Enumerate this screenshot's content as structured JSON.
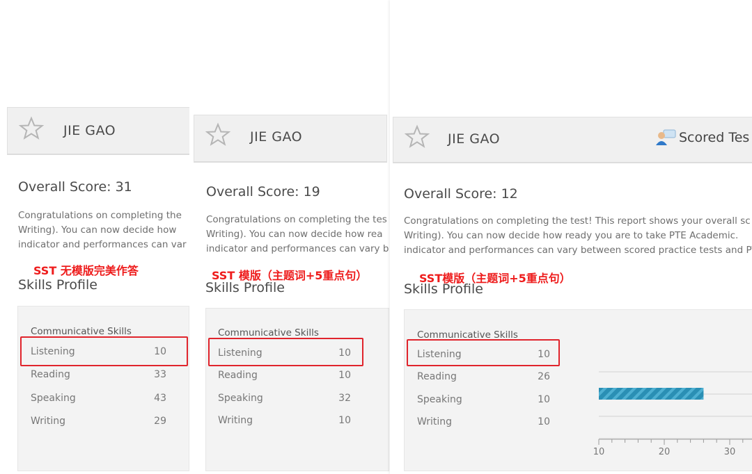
{
  "cards": [
    {
      "name": "JIE GAO",
      "overall": "Overall Score: 31",
      "desc": [
        "Congratulations on completing the",
        "Writing). You can now decide how",
        "indicator and performances can var"
      ],
      "note": "SST 无模版完美作答",
      "skills_title": "Skills Profile",
      "comm_title": "Communicative Skills",
      "skills": [
        {
          "label": "Listening",
          "score": "10"
        },
        {
          "label": "Reading",
          "score": "33"
        },
        {
          "label": "Speaking",
          "score": "43"
        },
        {
          "label": "Writing",
          "score": "29"
        }
      ]
    },
    {
      "name": "JIE GAO",
      "overall": "Overall Score: 19",
      "desc": [
        "Congratulations on completing the tes",
        "Writing). You can now decide how rea",
        "indicator and performances can vary b"
      ],
      "note": "SST 模版（主题词+5重点句）",
      "skills_title": "Skills Profile",
      "comm_title": "Communicative Skills",
      "skills": [
        {
          "label": "Listening",
          "score": "10"
        },
        {
          "label": "Reading",
          "score": "10"
        },
        {
          "label": "Speaking",
          "score": "32"
        },
        {
          "label": "Writing",
          "score": "10"
        }
      ]
    },
    {
      "name": "JIE GAO",
      "scored_label": "Scored Tes",
      "overall": "Overall Score: 12",
      "desc": [
        "Congratulations on completing the test! This report shows your overall sc",
        "Writing). You can now decide how ready you are to take PTE Academic. ",
        "indicator and performances can vary between scored practice tests and PT"
      ],
      "note": "SST模版（主题词+5重点句）",
      "skills_title": "Skills Profile",
      "comm_title": "Communicative Skills",
      "skills": [
        {
          "label": "Listening",
          "score": "10"
        },
        {
          "label": "Reading",
          "score": "26"
        },
        {
          "label": "Speaking",
          "score": "10"
        },
        {
          "label": "Writing",
          "score": "10"
        }
      ]
    }
  ],
  "chart_data": {
    "type": "bar",
    "orientation": "horizontal",
    "categories": [
      "Listening",
      "Reading",
      "Speaking",
      "Writing"
    ],
    "values": [
      10,
      26,
      10,
      10
    ],
    "x_ticks": [
      "10",
      "20",
      "30"
    ],
    "xlim": [
      10,
      30
    ],
    "bar_color": "#2a8fb4"
  },
  "colors": {
    "highlight": "#e0242c",
    "note": "#ee1c1c"
  },
  "icons": {
    "star": "star-icon",
    "clip": "binder-clip-icon",
    "user": "user-chat-icon"
  }
}
